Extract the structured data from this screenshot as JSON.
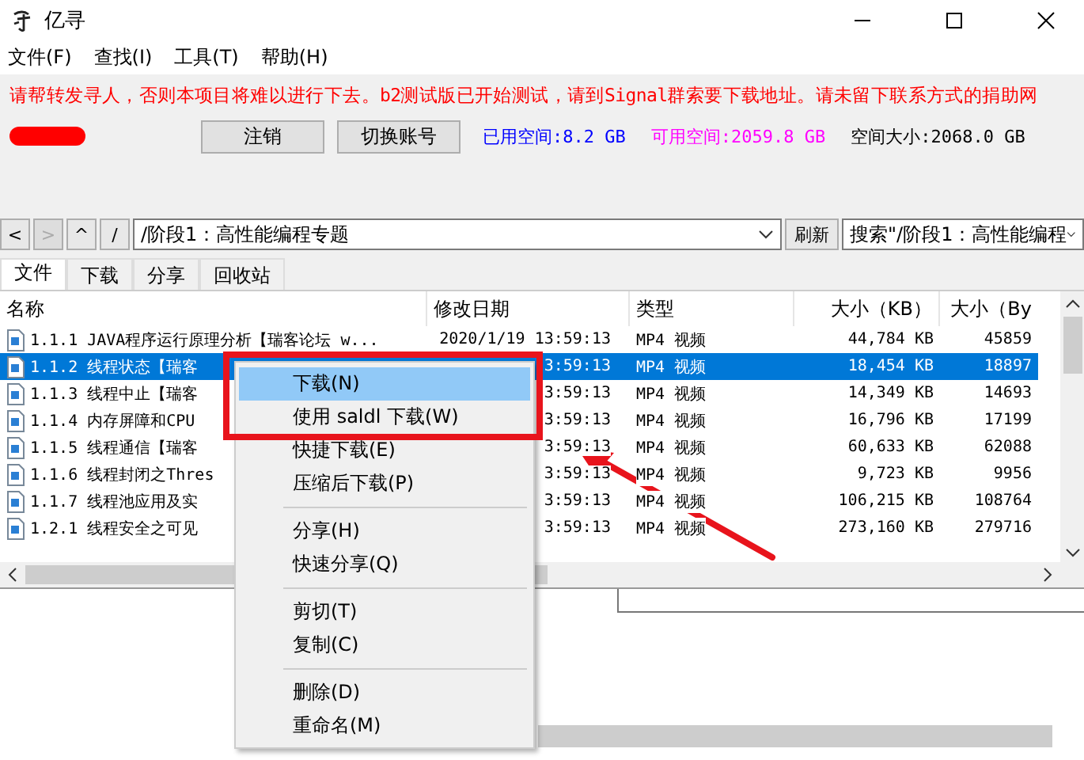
{
  "window": {
    "title": "亿寻"
  },
  "menu_bar": [
    "文件(F)",
    "查找(I)",
    "工具(T)",
    "帮助(H)"
  ],
  "notice": "请帮转发寻人，否则本项目将难以进行下去。b2测试版已开始测试，请到Signal群索要下载地址。请未留下联系方式的捐助网",
  "buttons": [
    "注销",
    "切换账号"
  ],
  "storage": [
    {
      "label": "已用空间:",
      "value": "8.2 GB",
      "color": "#0000ff"
    },
    {
      "label": "可用空间:",
      "value": "2059.8 GB",
      "color": "#ff00ff"
    },
    {
      "label": "空间大小:",
      "value": "2068.0 GB",
      "color": "#000000"
    }
  ],
  "nav_buttons": [
    {
      "label": "<",
      "disabled": false
    },
    {
      "label": ">",
      "disabled": true
    },
    {
      "label": "^",
      "disabled": false
    },
    {
      "label": "/",
      "disabled": false
    }
  ],
  "path": "/阶段1：高性能编程专题",
  "refresh": "刷新",
  "search": "搜索\"/阶段1：高性能编程",
  "tabs": [
    {
      "label": "文件",
      "selected": true
    },
    {
      "label": "下载",
      "selected": false
    },
    {
      "label": "分享",
      "selected": false
    },
    {
      "label": "回收站",
      "selected": false
    }
  ],
  "table": {
    "columns": [
      "名称",
      "修改日期",
      "类型",
      "大小（KB）",
      "大小（By"
    ],
    "rows": [
      {
        "name": "1.1.1 JAVA程序运行原理分析【瑞客论坛 w...",
        "date": "2020/1/19 13:59:13",
        "type": "MP4 视频",
        "kb": "44,784 KB",
        "bytes": "45859",
        "selected": false
      },
      {
        "name": "1.1.2 线程状态【瑞客",
        "date": "3:59:13",
        "type": "MP4 视频",
        "kb": "18,454 KB",
        "bytes": "18897",
        "selected": true
      },
      {
        "name": "1.1.3 线程中止【瑞客",
        "date": "3:59:13",
        "type": "MP4 视频",
        "kb": "14,349 KB",
        "bytes": "14693",
        "selected": false
      },
      {
        "name": "1.1.4 内存屏障和CPU",
        "date": "3:59:13",
        "type": "MP4 视频",
        "kb": "16,796 KB",
        "bytes": "17199",
        "selected": false
      },
      {
        "name": "1.1.5 线程通信【瑞客",
        "date": "3:59:13",
        "type": "MP4 视频",
        "kb": "60,633 KB",
        "bytes": "62088",
        "selected": false
      },
      {
        "name": "1.1.6 线程封闭之Thres",
        "date": "3:59:13",
        "type": "MP4 视频",
        "kb": "9,723 KB",
        "bytes": "9956",
        "selected": false
      },
      {
        "name": "1.1.7 线程池应用及实",
        "date": "3:59:13",
        "type": "MP4 视频",
        "kb": "106,215 KB",
        "bytes": "108764",
        "selected": false
      },
      {
        "name": "1.2.1 线程安全之可见",
        "date": "3:59:13",
        "type": "MP4 视频",
        "kb": "273,160 KB",
        "bytes": "279716",
        "selected": false
      }
    ]
  },
  "context_menu": [
    {
      "kind": "item",
      "label": "下载(N)",
      "selected": true
    },
    {
      "kind": "item",
      "label": "使用 saldl 下载(W)",
      "selected": false
    },
    {
      "kind": "item",
      "label": "快捷下载(E)",
      "selected": false
    },
    {
      "kind": "item",
      "label": "压缩后下载(P)",
      "selected": false
    },
    {
      "kind": "separator"
    },
    {
      "kind": "item",
      "label": "分享(H)",
      "selected": false
    },
    {
      "kind": "item",
      "label": "快速分享(Q)",
      "selected": false
    },
    {
      "kind": "separator"
    },
    {
      "kind": "item",
      "label": "剪切(T)",
      "selected": false
    },
    {
      "kind": "item",
      "label": "复制(C)",
      "selected": false
    },
    {
      "kind": "separator"
    },
    {
      "kind": "item",
      "label": "删除(D)",
      "selected": false
    },
    {
      "kind": "item",
      "label": "重命名(M)",
      "selected": false
    }
  ]
}
